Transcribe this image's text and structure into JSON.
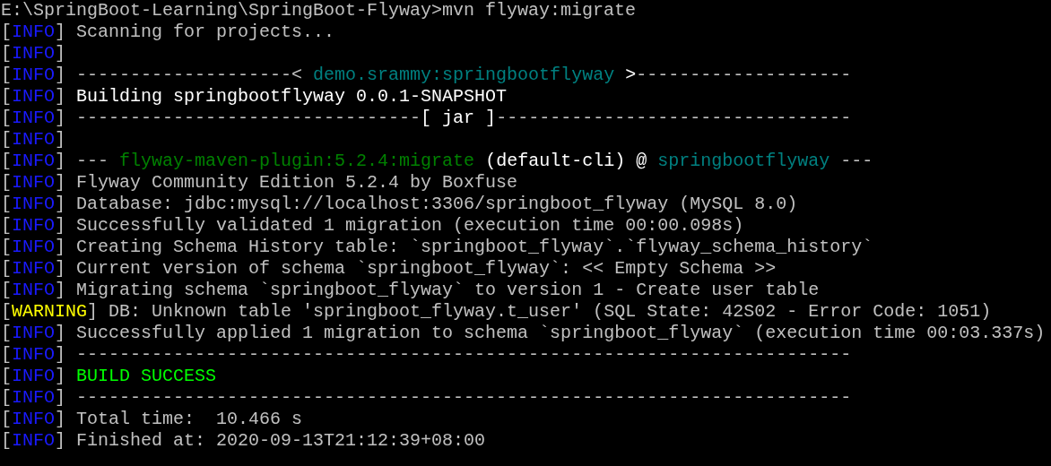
{
  "terminal": {
    "lines": [
      {
        "segments": [
          {
            "text": "E:\\SpringBoot-Learning\\SpringBoot-Flyway>mvn flyway:migrate",
            "kind": "plain"
          }
        ]
      },
      {
        "segments": [
          {
            "text": "[",
            "kind": "plain"
          },
          {
            "text": "INFO",
            "kind": "info"
          },
          {
            "text": "] Scanning for projects...",
            "kind": "plain"
          }
        ]
      },
      {
        "segments": [
          {
            "text": "[",
            "kind": "plain"
          },
          {
            "text": "INFO",
            "kind": "info"
          },
          {
            "text": "]",
            "kind": "plain"
          }
        ]
      },
      {
        "segments": [
          {
            "text": "[",
            "kind": "plain"
          },
          {
            "text": "INFO",
            "kind": "info"
          },
          {
            "text": "] --------------------< ",
            "kind": "plain"
          },
          {
            "text": "demo.srammy:springbootflyway",
            "kind": "teal"
          },
          {
            "text": " >",
            "kind": "bright"
          },
          {
            "text": "--------------------",
            "kind": "plain"
          }
        ]
      },
      {
        "segments": [
          {
            "text": "[",
            "kind": "plain"
          },
          {
            "text": "INFO",
            "kind": "info"
          },
          {
            "text": "] ",
            "kind": "plain"
          },
          {
            "text": "Building springbootflyway 0.0.1-SNAPSHOT",
            "kind": "bright"
          }
        ]
      },
      {
        "segments": [
          {
            "text": "[",
            "kind": "plain"
          },
          {
            "text": "INFO",
            "kind": "info"
          },
          {
            "text": "] --------------------------------",
            "kind": "plain"
          },
          {
            "text": "[ jar ]",
            "kind": "bright"
          },
          {
            "text": "---------------------------------",
            "kind": "plain"
          }
        ]
      },
      {
        "segments": [
          {
            "text": "[",
            "kind": "plain"
          },
          {
            "text": "INFO",
            "kind": "info"
          },
          {
            "text": "]",
            "kind": "plain"
          }
        ]
      },
      {
        "segments": [
          {
            "text": "[",
            "kind": "plain"
          },
          {
            "text": "INFO",
            "kind": "info"
          },
          {
            "text": "] --- ",
            "kind": "plain"
          },
          {
            "text": "flyway-maven-plugin:5.2.4:migrate",
            "kind": "green"
          },
          {
            "text": " (default-cli) @ ",
            "kind": "bright"
          },
          {
            "text": "springbootflyway",
            "kind": "teal"
          },
          {
            "text": " ---",
            "kind": "plain"
          }
        ]
      },
      {
        "segments": [
          {
            "text": "[",
            "kind": "plain"
          },
          {
            "text": "INFO",
            "kind": "info"
          },
          {
            "text": "] Flyway Community Edition 5.2.4 by Boxfuse",
            "kind": "plain"
          }
        ]
      },
      {
        "segments": [
          {
            "text": "[",
            "kind": "plain"
          },
          {
            "text": "INFO",
            "kind": "info"
          },
          {
            "text": "] Database: jdbc:mysql://localhost:3306/springboot_flyway (MySQL 8.0)",
            "kind": "plain"
          }
        ]
      },
      {
        "segments": [
          {
            "text": "[",
            "kind": "plain"
          },
          {
            "text": "INFO",
            "kind": "info"
          },
          {
            "text": "] Successfully validated 1 migration (execution time 00:00.098s)",
            "kind": "plain"
          }
        ]
      },
      {
        "segments": [
          {
            "text": "[",
            "kind": "plain"
          },
          {
            "text": "INFO",
            "kind": "info"
          },
          {
            "text": "] Creating Schema History table: `springboot_flyway`.`flyway_schema_history`",
            "kind": "plain"
          }
        ]
      },
      {
        "segments": [
          {
            "text": "[",
            "kind": "plain"
          },
          {
            "text": "INFO",
            "kind": "info"
          },
          {
            "text": "] Current version of schema `springboot_flyway`: << Empty Schema >>",
            "kind": "plain"
          }
        ]
      },
      {
        "segments": [
          {
            "text": "[",
            "kind": "plain"
          },
          {
            "text": "INFO",
            "kind": "info"
          },
          {
            "text": "] Migrating schema `springboot_flyway` to version 1 - Create user table",
            "kind": "plain"
          }
        ]
      },
      {
        "segments": [
          {
            "text": "[",
            "kind": "plain"
          },
          {
            "text": "WARNING",
            "kind": "warning"
          },
          {
            "text": "] DB: Unknown table 'springboot_flyway.t_user' (SQL State: 42S02 - Error Code: 1051)",
            "kind": "plain"
          }
        ]
      },
      {
        "segments": [
          {
            "text": "[",
            "kind": "plain"
          },
          {
            "text": "INFO",
            "kind": "info"
          },
          {
            "text": "] Successfully applied 1 migration to schema `springboot_flyway` (execution time 00:03.337s)",
            "kind": "plain"
          }
        ]
      },
      {
        "segments": [
          {
            "text": "[",
            "kind": "plain"
          },
          {
            "text": "INFO",
            "kind": "info"
          },
          {
            "text": "] ------------------------------------------------------------------------",
            "kind": "plain"
          }
        ]
      },
      {
        "segments": [
          {
            "text": "[",
            "kind": "plain"
          },
          {
            "text": "INFO",
            "kind": "info"
          },
          {
            "text": "] ",
            "kind": "plain"
          },
          {
            "text": "BUILD SUCCESS",
            "kind": "success"
          }
        ]
      },
      {
        "segments": [
          {
            "text": "[",
            "kind": "plain"
          },
          {
            "text": "INFO",
            "kind": "info"
          },
          {
            "text": "] ------------------------------------------------------------------------",
            "kind": "plain"
          }
        ]
      },
      {
        "segments": [
          {
            "text": "[",
            "kind": "plain"
          },
          {
            "text": "INFO",
            "kind": "info"
          },
          {
            "text": "] Total time:  10.466 s",
            "kind": "plain"
          }
        ]
      },
      {
        "segments": [
          {
            "text": "[",
            "kind": "plain"
          },
          {
            "text": "INFO",
            "kind": "info"
          },
          {
            "text": "] Finished at: 2020-09-13T21:12:39+08:00",
            "kind": "plain"
          }
        ]
      }
    ]
  }
}
